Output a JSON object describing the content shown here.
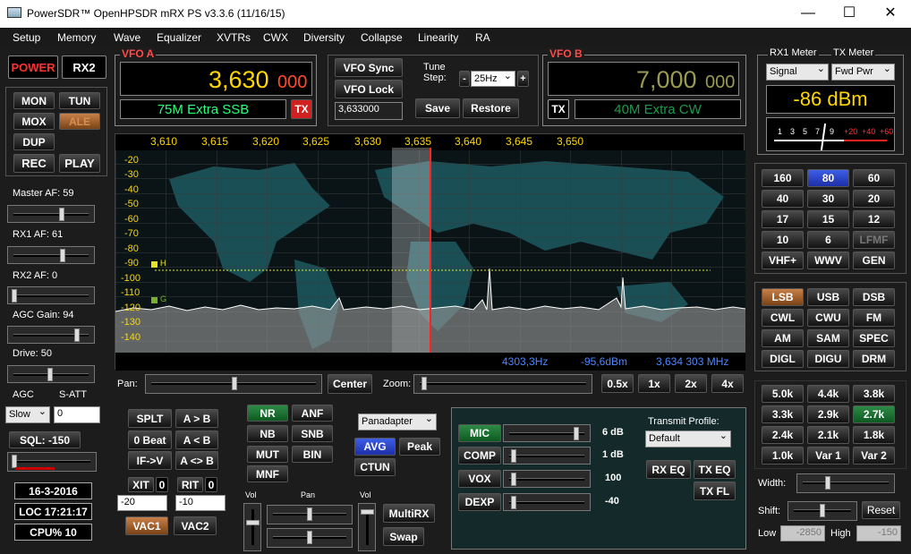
{
  "window": {
    "title": "PowerSDR™ OpenHPSDR mRX PS v3.3.6 (11/16/15)",
    "minimize": "—",
    "maximize": "☐",
    "close": "✕"
  },
  "menu": [
    "Setup",
    "Memory",
    "Wave",
    "Equalizer",
    "XVTRs",
    "CWX",
    "Diversity",
    "Collapse",
    "Linearity",
    "RA"
  ],
  "left": {
    "power": "POWER",
    "rx2": "RX2",
    "mon": "MON",
    "tun": "TUN",
    "mox": "MOX",
    "ale": "ALE",
    "dup": "DUP",
    "rec": "REC",
    "play": "PLAY",
    "master_af": "Master AF:  59",
    "rx1_af": "RX1 AF:  61",
    "rx2_af": "RX2 AF:  0",
    "agc_gain": "AGC Gain:  94",
    "drive": "Drive:  50",
    "agc": "AGC",
    "satt": "S-ATT",
    "agc_mode": "Slow",
    "satt_val": "0",
    "sql": "SQL: -150",
    "date": "16-3-2016",
    "loc": "LOC 17:21:17",
    "cpu": "CPU%  10"
  },
  "vfoa": {
    "label": "VFO A",
    "freq_main": "3,630",
    "freq_sub": "000",
    "band": "75M Extra SSB",
    "tx": "TX"
  },
  "vfob": {
    "label": "VFO B",
    "freq_main": "7,000",
    "freq_sub": "000",
    "band": "40M Extra CW",
    "tx": "TX"
  },
  "center": {
    "vfo_sync": "VFO Sync",
    "vfo_lock": "VFO Lock",
    "tune_step_label": "Tune\nStep:",
    "tune_minus": "-",
    "tune_step": "25Hz",
    "tune_plus": "+",
    "freq_input": "3,633000",
    "save": "Save",
    "restore": "Restore"
  },
  "meter": {
    "rx1_label": "RX1 Meter",
    "tx_label": "TX Meter",
    "rx1_sel": "Signal",
    "tx_sel": "Fwd Pwr",
    "reading": "-86 dBm",
    "scale": [
      "1",
      "3",
      "5",
      "7",
      "9",
      "+20",
      "+40",
      "+60"
    ]
  },
  "display": {
    "freqs": [
      "3,610",
      "3,615",
      "3,620",
      "3,625",
      "3,630",
      "3,635",
      "3,640",
      "3,645",
      "3,650"
    ],
    "dbs": [
      "-20",
      "-30",
      "-40",
      "-50",
      "-60",
      "-70",
      "-80",
      "-90",
      "-100",
      "-110",
      "-120",
      "-130",
      "-140"
    ],
    "h_marker": "H",
    "g_marker": "G",
    "status_hz": "4303,3Hz",
    "status_dbm": "-95,6dBm",
    "status_mhz": "3,634 303 MHz"
  },
  "pan_zoom": {
    "pan": "Pan:",
    "center": "Center",
    "zoom": "Zoom:",
    "z05": "0.5x",
    "z1": "1x",
    "z2": "2x",
    "z4": "4x"
  },
  "bands": [
    "160",
    "80",
    "60",
    "40",
    "30",
    "20",
    "17",
    "15",
    "12",
    "10",
    "6",
    "LFMF",
    "VHF+",
    "WWV",
    "GEN"
  ],
  "modes": [
    "LSB",
    "USB",
    "DSB",
    "CWL",
    "CWU",
    "FM",
    "AM",
    "SAM",
    "SPEC",
    "DIGL",
    "DIGU",
    "DRM"
  ],
  "filters": [
    "5.0k",
    "4.4k",
    "3.8k",
    "3.3k",
    "2.9k",
    "2.7k",
    "2.4k",
    "2.1k",
    "1.8k",
    "1.0k",
    "Var 1",
    "Var 2"
  ],
  "filter_ctrl": {
    "width": "Width:",
    "shift": "Shift:",
    "reset": "Reset",
    "low": "Low",
    "low_val": "-2850",
    "high": "High",
    "high_val": "-150"
  },
  "bottom": {
    "splt": "SPLT",
    "a2b": "A > B",
    "zerobeat": "0 Beat",
    "b2a": "A < B",
    "ifv": "IF->V",
    "aswapb": "A <> B",
    "xit": "XIT",
    "xit_val": "0",
    "xit_step": "-20",
    "rit": "RIT",
    "rit_val": "0",
    "rit_step": "-10",
    "vac1": "VAC1",
    "vac2": "VAC2",
    "nr": "NR",
    "anf": "ANF",
    "nb": "NB",
    "snb": "SNB",
    "mut": "MUT",
    "bin": "BIN",
    "mnf": "MNF",
    "panadapter": "Panadapter",
    "avg": "AVG",
    "peak": "Peak",
    "ctun": "CTUN",
    "vol": "Vol",
    "pan": "Pan",
    "vol2": "Vol",
    "multirx": "MultiRX",
    "swap": "Swap"
  },
  "tx": {
    "mic": "MIC",
    "mic_val": "6 dB",
    "comp": "COMP",
    "comp_val": "1 dB",
    "vox": "VOX",
    "vox_val": "100",
    "dexp": "DEXP",
    "dexp_val": "-40",
    "profile_label": "Transmit Profile:",
    "profile": "Default",
    "rxeq": "RX EQ",
    "txeq": "TX EQ",
    "txfl": "TX FL"
  }
}
